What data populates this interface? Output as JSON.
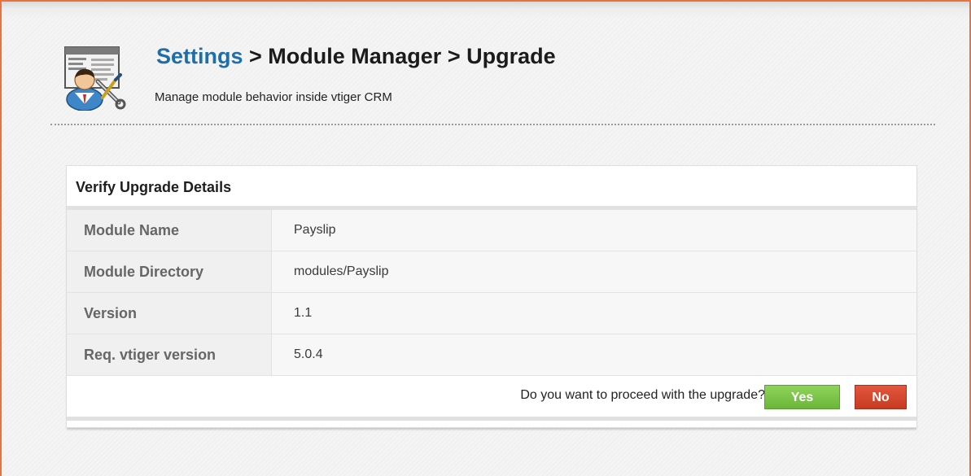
{
  "header": {
    "breadcrumb": {
      "settings": "Settings",
      "sep1": " > ",
      "module_manager": "Module Manager",
      "sep2": " > ",
      "current": "Upgrade"
    },
    "subtitle": "Manage module behavior inside vtiger CRM",
    "icon": "settings-user-tools-icon"
  },
  "panel": {
    "title": "Verify Upgrade Details",
    "rows": [
      {
        "label": "Module Name",
        "value": "Payslip"
      },
      {
        "label": "Module Directory",
        "value": "modules/Payslip"
      },
      {
        "label": "Version",
        "value": "1.1"
      },
      {
        "label": "Req. vtiger version",
        "value": "5.0.4"
      }
    ],
    "footer": {
      "question": "Do you want to proceed with the upgrade?",
      "yes_label": "Yes",
      "no_label": "No"
    }
  },
  "colors": {
    "link_blue": "#1f6ea8",
    "frame_orange": "#e8733f",
    "yes_green": "#7cc348",
    "no_red": "#d5482f"
  }
}
